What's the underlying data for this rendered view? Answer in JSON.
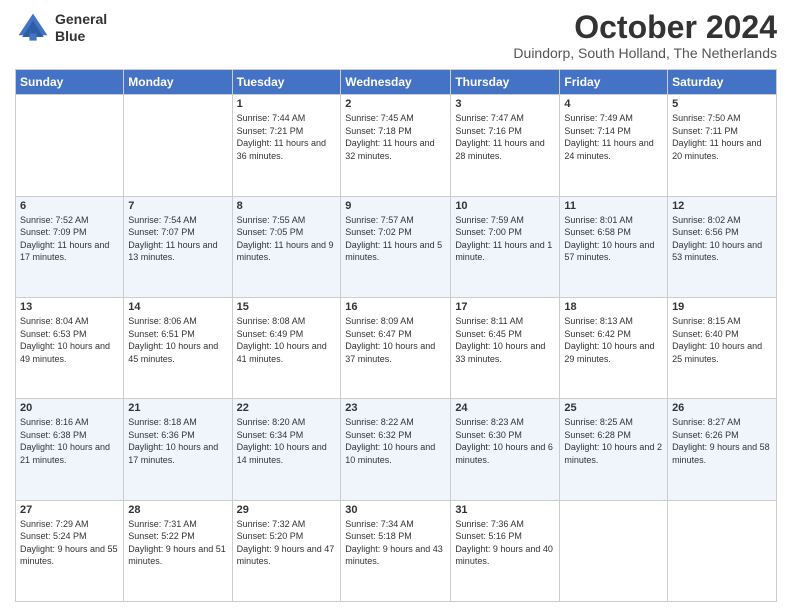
{
  "header": {
    "logo_line1": "General",
    "logo_line2": "Blue",
    "title": "October 2024",
    "subtitle": "Duindorp, South Holland, The Netherlands"
  },
  "days_of_week": [
    "Sunday",
    "Monday",
    "Tuesday",
    "Wednesday",
    "Thursday",
    "Friday",
    "Saturday"
  ],
  "weeks": [
    [
      {
        "num": "",
        "sunrise": "",
        "sunset": "",
        "daylight": ""
      },
      {
        "num": "",
        "sunrise": "",
        "sunset": "",
        "daylight": ""
      },
      {
        "num": "1",
        "sunrise": "Sunrise: 7:44 AM",
        "sunset": "Sunset: 7:21 PM",
        "daylight": "Daylight: 11 hours and 36 minutes."
      },
      {
        "num": "2",
        "sunrise": "Sunrise: 7:45 AM",
        "sunset": "Sunset: 7:18 PM",
        "daylight": "Daylight: 11 hours and 32 minutes."
      },
      {
        "num": "3",
        "sunrise": "Sunrise: 7:47 AM",
        "sunset": "Sunset: 7:16 PM",
        "daylight": "Daylight: 11 hours and 28 minutes."
      },
      {
        "num": "4",
        "sunrise": "Sunrise: 7:49 AM",
        "sunset": "Sunset: 7:14 PM",
        "daylight": "Daylight: 11 hours and 24 minutes."
      },
      {
        "num": "5",
        "sunrise": "Sunrise: 7:50 AM",
        "sunset": "Sunset: 7:11 PM",
        "daylight": "Daylight: 11 hours and 20 minutes."
      }
    ],
    [
      {
        "num": "6",
        "sunrise": "Sunrise: 7:52 AM",
        "sunset": "Sunset: 7:09 PM",
        "daylight": "Daylight: 11 hours and 17 minutes."
      },
      {
        "num": "7",
        "sunrise": "Sunrise: 7:54 AM",
        "sunset": "Sunset: 7:07 PM",
        "daylight": "Daylight: 11 hours and 13 minutes."
      },
      {
        "num": "8",
        "sunrise": "Sunrise: 7:55 AM",
        "sunset": "Sunset: 7:05 PM",
        "daylight": "Daylight: 11 hours and 9 minutes."
      },
      {
        "num": "9",
        "sunrise": "Sunrise: 7:57 AM",
        "sunset": "Sunset: 7:02 PM",
        "daylight": "Daylight: 11 hours and 5 minutes."
      },
      {
        "num": "10",
        "sunrise": "Sunrise: 7:59 AM",
        "sunset": "Sunset: 7:00 PM",
        "daylight": "Daylight: 11 hours and 1 minute."
      },
      {
        "num": "11",
        "sunrise": "Sunrise: 8:01 AM",
        "sunset": "Sunset: 6:58 PM",
        "daylight": "Daylight: 10 hours and 57 minutes."
      },
      {
        "num": "12",
        "sunrise": "Sunrise: 8:02 AM",
        "sunset": "Sunset: 6:56 PM",
        "daylight": "Daylight: 10 hours and 53 minutes."
      }
    ],
    [
      {
        "num": "13",
        "sunrise": "Sunrise: 8:04 AM",
        "sunset": "Sunset: 6:53 PM",
        "daylight": "Daylight: 10 hours and 49 minutes."
      },
      {
        "num": "14",
        "sunrise": "Sunrise: 8:06 AM",
        "sunset": "Sunset: 6:51 PM",
        "daylight": "Daylight: 10 hours and 45 minutes."
      },
      {
        "num": "15",
        "sunrise": "Sunrise: 8:08 AM",
        "sunset": "Sunset: 6:49 PM",
        "daylight": "Daylight: 10 hours and 41 minutes."
      },
      {
        "num": "16",
        "sunrise": "Sunrise: 8:09 AM",
        "sunset": "Sunset: 6:47 PM",
        "daylight": "Daylight: 10 hours and 37 minutes."
      },
      {
        "num": "17",
        "sunrise": "Sunrise: 8:11 AM",
        "sunset": "Sunset: 6:45 PM",
        "daylight": "Daylight: 10 hours and 33 minutes."
      },
      {
        "num": "18",
        "sunrise": "Sunrise: 8:13 AM",
        "sunset": "Sunset: 6:42 PM",
        "daylight": "Daylight: 10 hours and 29 minutes."
      },
      {
        "num": "19",
        "sunrise": "Sunrise: 8:15 AM",
        "sunset": "Sunset: 6:40 PM",
        "daylight": "Daylight: 10 hours and 25 minutes."
      }
    ],
    [
      {
        "num": "20",
        "sunrise": "Sunrise: 8:16 AM",
        "sunset": "Sunset: 6:38 PM",
        "daylight": "Daylight: 10 hours and 21 minutes."
      },
      {
        "num": "21",
        "sunrise": "Sunrise: 8:18 AM",
        "sunset": "Sunset: 6:36 PM",
        "daylight": "Daylight: 10 hours and 17 minutes."
      },
      {
        "num": "22",
        "sunrise": "Sunrise: 8:20 AM",
        "sunset": "Sunset: 6:34 PM",
        "daylight": "Daylight: 10 hours and 14 minutes."
      },
      {
        "num": "23",
        "sunrise": "Sunrise: 8:22 AM",
        "sunset": "Sunset: 6:32 PM",
        "daylight": "Daylight: 10 hours and 10 minutes."
      },
      {
        "num": "24",
        "sunrise": "Sunrise: 8:23 AM",
        "sunset": "Sunset: 6:30 PM",
        "daylight": "Daylight: 10 hours and 6 minutes."
      },
      {
        "num": "25",
        "sunrise": "Sunrise: 8:25 AM",
        "sunset": "Sunset: 6:28 PM",
        "daylight": "Daylight: 10 hours and 2 minutes."
      },
      {
        "num": "26",
        "sunrise": "Sunrise: 8:27 AM",
        "sunset": "Sunset: 6:26 PM",
        "daylight": "Daylight: 9 hours and 58 minutes."
      }
    ],
    [
      {
        "num": "27",
        "sunrise": "Sunrise: 7:29 AM",
        "sunset": "Sunset: 5:24 PM",
        "daylight": "Daylight: 9 hours and 55 minutes."
      },
      {
        "num": "28",
        "sunrise": "Sunrise: 7:31 AM",
        "sunset": "Sunset: 5:22 PM",
        "daylight": "Daylight: 9 hours and 51 minutes."
      },
      {
        "num": "29",
        "sunrise": "Sunrise: 7:32 AM",
        "sunset": "Sunset: 5:20 PM",
        "daylight": "Daylight: 9 hours and 47 minutes."
      },
      {
        "num": "30",
        "sunrise": "Sunrise: 7:34 AM",
        "sunset": "Sunset: 5:18 PM",
        "daylight": "Daylight: 9 hours and 43 minutes."
      },
      {
        "num": "31",
        "sunrise": "Sunrise: 7:36 AM",
        "sunset": "Sunset: 5:16 PM",
        "daylight": "Daylight: 9 hours and 40 minutes."
      },
      {
        "num": "",
        "sunrise": "",
        "sunset": "",
        "daylight": ""
      },
      {
        "num": "",
        "sunrise": "",
        "sunset": "",
        "daylight": ""
      }
    ]
  ]
}
